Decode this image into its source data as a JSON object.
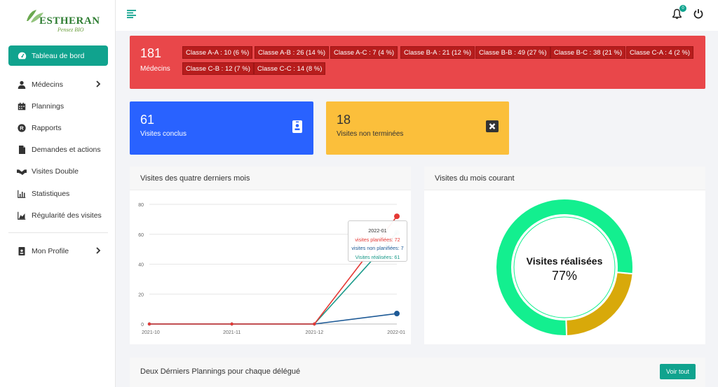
{
  "brand": {
    "name": "ESTHERAN",
    "tagline": "Pensez BIO"
  },
  "sidebar": {
    "items": [
      {
        "label": "Tableau de bord",
        "icon": "dashboard-gauge-icon"
      },
      {
        "label": "Médecins",
        "icon": "user-doctor-icon"
      },
      {
        "label": "Plannings",
        "icon": "calendar-icon"
      },
      {
        "label": "Rapports",
        "icon": "registered-icon"
      },
      {
        "label": "Demandes et actions",
        "icon": "file-icon"
      },
      {
        "label": "Visites Double",
        "icon": "handshake-icon"
      },
      {
        "label": "Statistiques",
        "icon": "bar-chart-icon"
      },
      {
        "label": "Régularité des visites",
        "icon": "area-chart-icon"
      },
      {
        "label": "Mon Profile",
        "icon": "id-badge-icon"
      }
    ]
  },
  "topbar": {
    "notifications": "0"
  },
  "doctors": {
    "count": "181",
    "label": "Médecins",
    "classes": [
      "Classe A-A : 10 (6 %)",
      "Classe A-B : 26 (14 %)",
      "Classe A-C : 7 (4 %)",
      "Classe B-A : 21 (12 %)",
      "Classe B-B : 49 (27 %)",
      "Classe B-C : 38 (21 %)",
      "Classe C-A : 4 (2 %)",
      "Classe C-B : 12 (7 %)",
      "Classe C-C : 14 (8 %)"
    ]
  },
  "stats": {
    "done": {
      "value": "61",
      "label": "Visites conclus"
    },
    "unfinished": {
      "value": "18",
      "label": "Visites non terminées"
    }
  },
  "panels": {
    "line_title": "Visites des quatre derniers mois",
    "donut_title": "Visites du mois courant",
    "bottom_title": "Deux Dérniers Plannings pour chaque délégué",
    "voir_tout": "Voir tout"
  },
  "tooltip": {
    "title": "2022-01",
    "line1": "visites planifiées: 72",
    "line2": "visites non planifiées: 7",
    "line3": "Visites réalisées: 61"
  },
  "donut": {
    "label": "Visites réalisées",
    "percent": "77%",
    "value": 77
  },
  "colors": {
    "accent": "#10a38e",
    "red": "#e9474a",
    "blue": "#2962ff",
    "yellow": "#fbbf3b",
    "donut_done": "#13ef8f",
    "donut_rest": "#d8a90a"
  },
  "chart_data": [
    {
      "type": "line",
      "x": [
        "2021-10",
        "2021-11",
        "2021-12",
        "2022-01"
      ],
      "yticks": [
        0,
        20,
        40,
        60,
        80
      ],
      "ylim": [
        0,
        80
      ],
      "grid": true,
      "series": [
        {
          "name": "visites planifiées",
          "values": [
            0,
            0,
            0,
            72
          ],
          "color": "#e53935"
        },
        {
          "name": "visites non planifiées",
          "values": [
            0,
            0,
            0,
            7
          ],
          "color": "#1e5a96"
        },
        {
          "name": "Visites réalisées",
          "values": [
            0,
            0,
            0,
            61
          ],
          "color": "#1a9a8a"
        }
      ]
    },
    {
      "type": "pie",
      "categories": [
        "Visites réalisées",
        ""
      ],
      "values": [
        77,
        23
      ],
      "colors": [
        "#13ef8f",
        "#d8a90a"
      ]
    }
  ]
}
